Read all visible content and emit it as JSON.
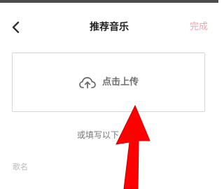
{
  "nav": {
    "title": "推荐音乐",
    "done_label": "完成"
  },
  "upload": {
    "label": "点击上传"
  },
  "form": {
    "or_text": "或填写以下",
    "song_name_label": "歌名"
  },
  "colors": {
    "title": "#222222",
    "done": "#f2a0b2",
    "upload_text": "#6f6f6f",
    "border": "#d6d6d6",
    "arrow": "#ff0000"
  },
  "icons": {
    "back": "chevron-left-icon",
    "upload": "cloud-upload-icon",
    "overlay": "red-arrow-icon"
  }
}
